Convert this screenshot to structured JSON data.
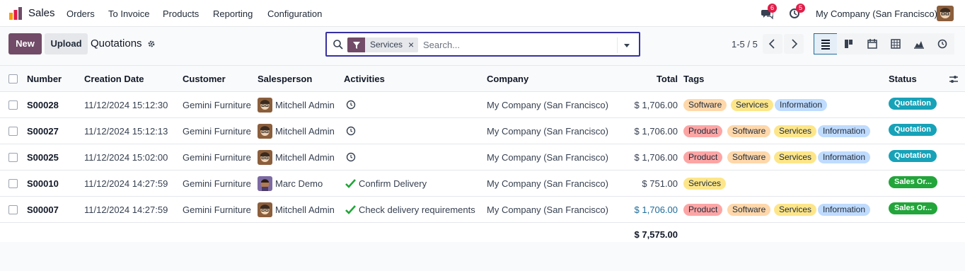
{
  "navbar": {
    "app_name": "Sales",
    "menu": [
      "Orders",
      "To Invoice",
      "Products",
      "Reporting",
      "Configuration"
    ],
    "messages_count": "6",
    "activities_count": "5",
    "company": "My Company (San Francisco)"
  },
  "control": {
    "new_label": "New",
    "upload_label": "Upload",
    "title": "Quotations",
    "facet_label": "Services",
    "facet_remove": "×",
    "search_placeholder": "Search...",
    "pager": "1-5 / 5"
  },
  "table": {
    "columns": [
      "Number",
      "Creation Date",
      "Customer",
      "Salesperson",
      "Activities",
      "Company",
      "Total",
      "Tags",
      "Status"
    ],
    "rows": [
      {
        "number": "S00028",
        "date": "11/12/2024 15:12:30",
        "customer": "Gemini Furniture",
        "salesperson": "Mitchell Admin",
        "activity": "",
        "company": "My Company (San Francisco)",
        "total": "$ 1,706.00",
        "tags": [
          "Software",
          "Services",
          "Information"
        ],
        "status": "Quotation"
      },
      {
        "number": "S00027",
        "date": "11/12/2024 15:12:13",
        "customer": "Gemini Furniture",
        "salesperson": "Mitchell Admin",
        "activity": "",
        "company": "My Company (San Francisco)",
        "total": "$ 1,706.00",
        "tags": [
          "Product",
          "Software",
          "Services",
          "Information"
        ],
        "status": "Quotation"
      },
      {
        "number": "S00025",
        "date": "11/12/2024 15:02:00",
        "customer": "Gemini Furniture",
        "salesperson": "Mitchell Admin",
        "activity": "",
        "company": "My Company (San Francisco)",
        "total": "$ 1,706.00",
        "tags": [
          "Product",
          "Software",
          "Services",
          "Information"
        ],
        "status": "Quotation"
      },
      {
        "number": "S00010",
        "date": "11/12/2024 14:27:59",
        "customer": "Gemini Furniture",
        "salesperson": "Marc Demo",
        "activity": "Confirm Delivery",
        "company": "My Company (San Francisco)",
        "total": "$ 751.00",
        "tags": [
          "Services"
        ],
        "status": "Sales Or..."
      },
      {
        "number": "S00007",
        "date": "11/12/2024 14:27:59",
        "customer": "Gemini Furniture",
        "salesperson": "Mitchell Admin",
        "activity": "Check delivery requirements",
        "company": "My Company (San Francisco)",
        "total": "$ 1,706.00",
        "tags": [
          "Product",
          "Software",
          "Services",
          "Information"
        ],
        "status": "Sales Or..."
      }
    ],
    "grand_total": "$ 7,575.00"
  },
  "colors": {
    "brand": "#714b67",
    "quotation": "#17a2b8",
    "sales_order": "#22a53a",
    "link": "#1e6d9b"
  }
}
